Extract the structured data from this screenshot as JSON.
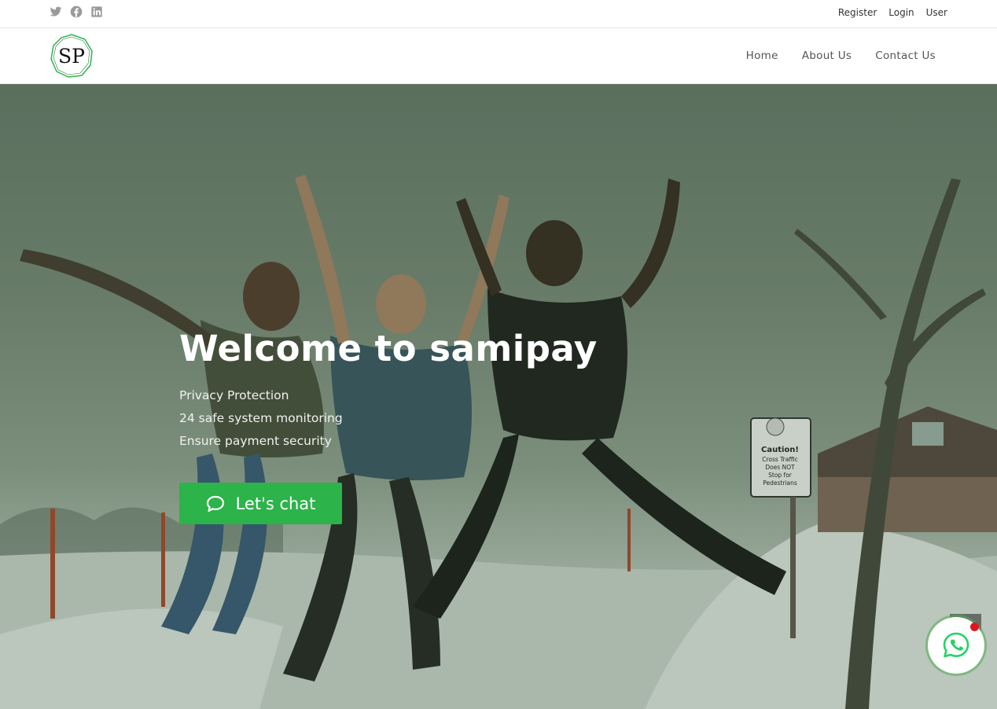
{
  "topbar": {
    "social": [
      {
        "name": "twitter-icon"
      },
      {
        "name": "facebook-icon"
      },
      {
        "name": "linkedin-icon"
      }
    ],
    "links": [
      "Register",
      "Login",
      "User"
    ]
  },
  "header": {
    "logo_text": "SP",
    "nav": [
      "Home",
      "About Us",
      "Contact Us"
    ]
  },
  "hero": {
    "title": "Welcome to samipay",
    "features": [
      "Privacy Protection",
      "24 safe system monitoring",
      "Ensure payment security"
    ],
    "cta_label": "Let's chat",
    "sign_text": [
      "Caution!",
      "Cross Traffic",
      "Does NOT",
      "Stop for",
      "Pedestrians"
    ]
  },
  "colors": {
    "accent": "#2cb34a",
    "whatsapp": "#25d366",
    "notification": "#e0161e"
  }
}
